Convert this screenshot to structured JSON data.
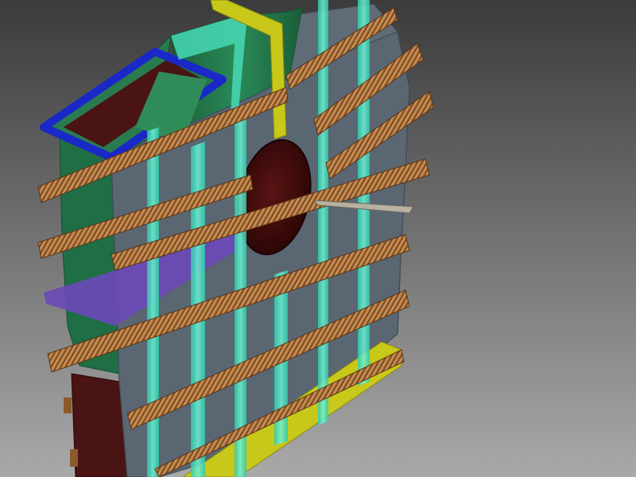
{
  "viewport": {
    "background_top": "#3b3b3b",
    "background_bottom": "#a9a9a9"
  },
  "colors": {
    "casing_face": "#5d6975",
    "casing_face_light": "#6c7884",
    "casing_edge": "#3f4a54",
    "inlet_green": "#1f6e45",
    "inlet_green_dark": "#154f32",
    "inlet_green_light": "#2a8a57",
    "outlet_interior": "#4a1414",
    "flange_blue": "#1a28c8",
    "flange_purple": "#6a48b8",
    "base_yellow": "#c8c81a",
    "stiffener_cyan": "#40e0c0",
    "rib_wood_light": "#c98a4a",
    "rib_wood_dark": "#7a4a22",
    "inlet_hole": "#4a0f0f"
  },
  "icons": {
    "model": "fan-housing-3d-model"
  }
}
